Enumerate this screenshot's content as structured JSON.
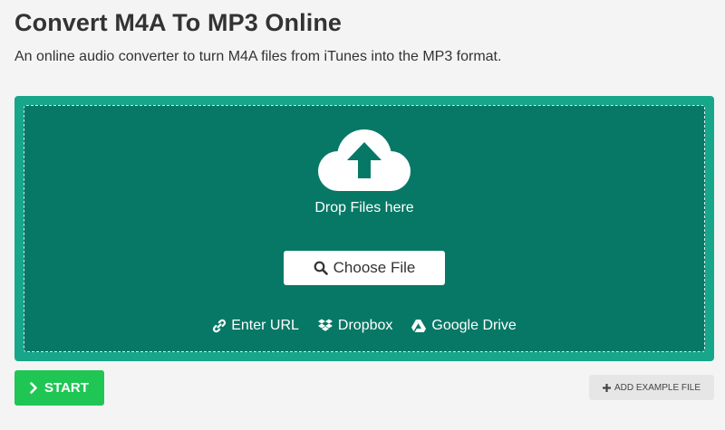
{
  "header": {
    "title": "Convert M4A To MP3 Online",
    "subtitle": "An online audio converter to turn M4A files from iTunes into the MP3 format."
  },
  "uploader": {
    "drop_text": "Drop Files here",
    "choose_file_label": "Choose File",
    "sources": [
      {
        "label": "Enter URL",
        "icon": "link-icon"
      },
      {
        "label": "Dropbox",
        "icon": "dropbox-icon"
      },
      {
        "label": "Google Drive",
        "icon": "google-drive-icon"
      }
    ]
  },
  "actions": {
    "start_label": "START",
    "add_example_label": "ADD EXAMPLE FILE"
  },
  "colors": {
    "uploader_outer": "#17a68a",
    "uploader_inner": "#077866",
    "start_button": "#1fc654",
    "example_button": "#e6e6e6"
  }
}
